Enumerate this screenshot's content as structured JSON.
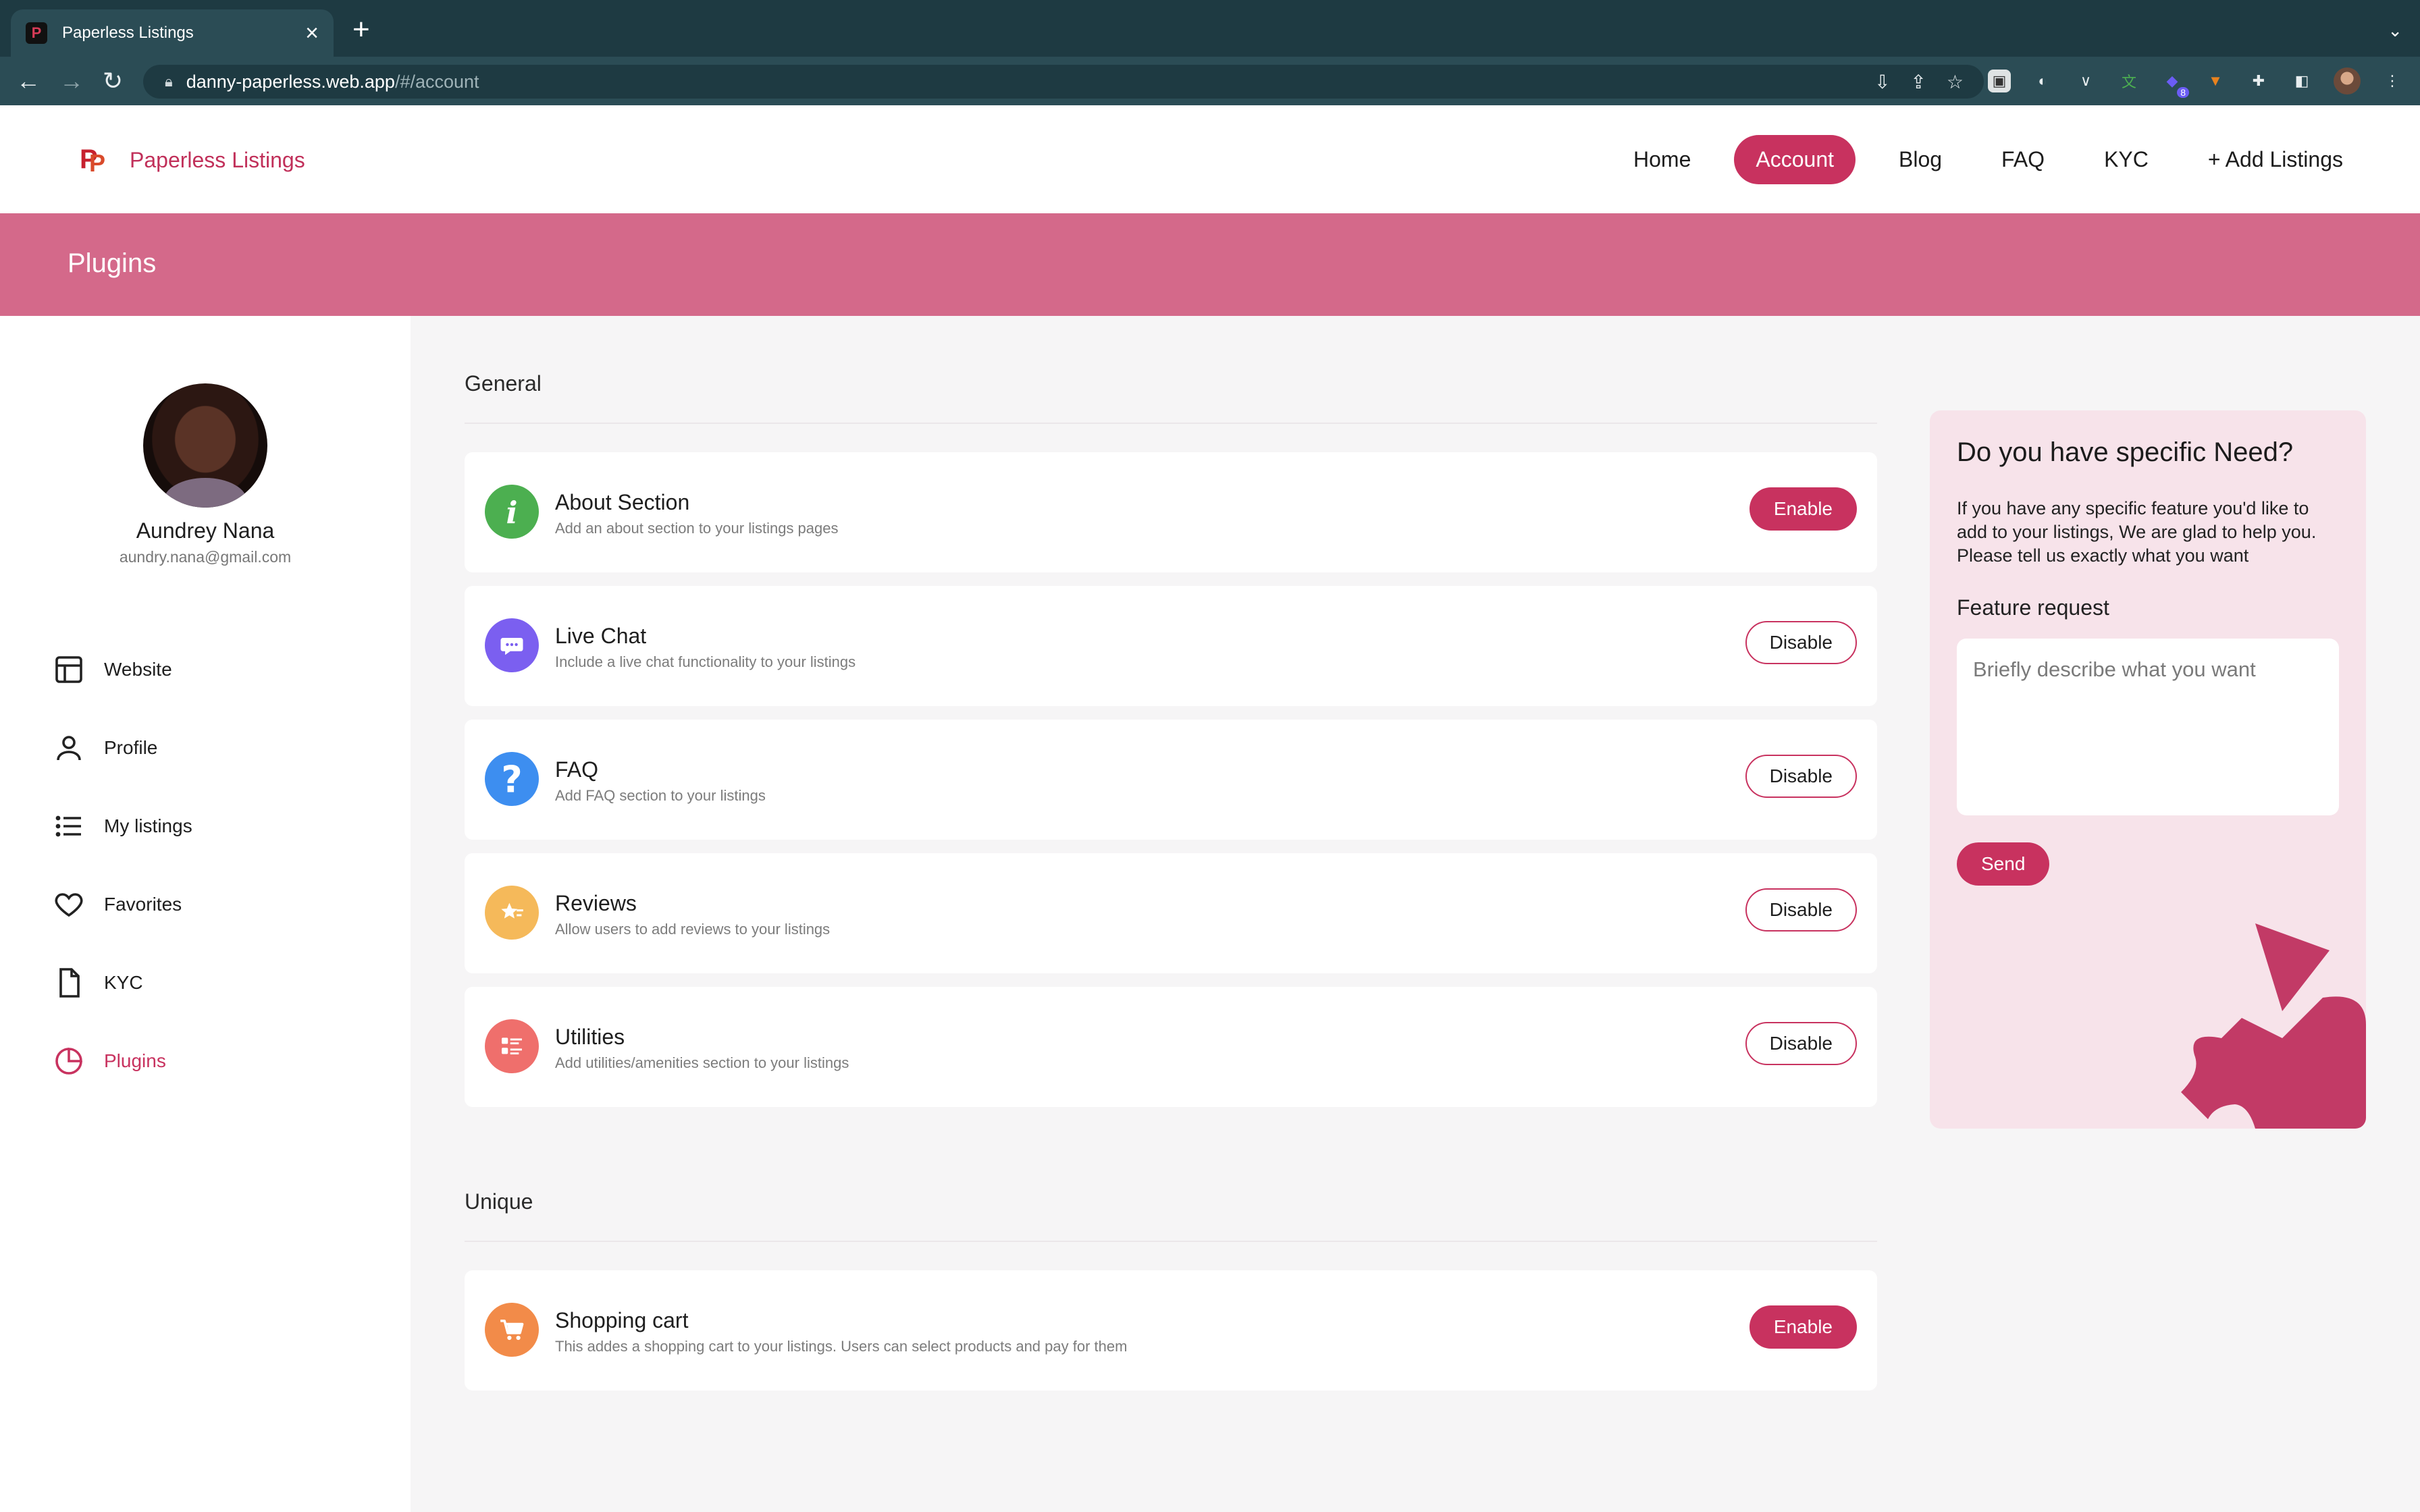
{
  "browser": {
    "tab_title": "Paperless Listings",
    "url_host": "danny-paperless.web.app",
    "url_path": "/#/account",
    "extension_badge": "8"
  },
  "header": {
    "logo_text": "Paperless Listings",
    "nav": [
      {
        "label": "Home"
      },
      {
        "label": "Account",
        "active": true
      },
      {
        "label": "Blog"
      },
      {
        "label": "FAQ"
      },
      {
        "label": "KYC"
      },
      {
        "label": "+ Add Listings"
      }
    ]
  },
  "banner": {
    "title": "Plugins"
  },
  "user": {
    "name": "Aundrey Nana",
    "email": "aundry.nana@gmail.com"
  },
  "sidebar": {
    "items": [
      {
        "label": "Website",
        "icon": "layout-icon"
      },
      {
        "label": "Profile",
        "icon": "user-icon"
      },
      {
        "label": "My listings",
        "icon": "list-icon"
      },
      {
        "label": "Favorites",
        "icon": "heart-icon"
      },
      {
        "label": "KYC",
        "icon": "document-icon"
      },
      {
        "label": "Plugins",
        "icon": "pie-chart-icon",
        "active": true
      }
    ]
  },
  "sections": {
    "general": {
      "title": "General",
      "plugins": [
        {
          "name": "About Section",
          "description": "Add an about section to your listings pages",
          "button": "Enable",
          "icon": "info-icon",
          "color": "#4caf50"
        },
        {
          "name": "Live Chat",
          "description": "Include a live chat functionality to your listings",
          "button": "Disable",
          "icon": "chat-icon",
          "color": "#7b5ff0"
        },
        {
          "name": "FAQ",
          "description": "Add FAQ section to your listings",
          "button": "Disable",
          "icon": "question-icon",
          "color": "#3d8ef0"
        },
        {
          "name": "Reviews",
          "description": "Allow users to add reviews to your listings",
          "button": "Disable",
          "icon": "star-review-icon",
          "color": "#f5b95a"
        },
        {
          "name": "Utilities",
          "description": "Add utilities/amenities section to your listings",
          "button": "Disable",
          "icon": "utilities-icon",
          "color": "#ef6f6c"
        }
      ]
    },
    "unique": {
      "title": "Unique",
      "plugins": [
        {
          "name": "Shopping cart",
          "description": "This addes a shopping cart to your listings. Users can select products and pay for them",
          "button": "Enable",
          "icon": "cart-icon",
          "color": "#f28b49"
        }
      ]
    }
  },
  "request": {
    "title": "Do you have specific Need?",
    "description": "If you have any specific feature you'd like to add to your listings, We are glad to help you. Please tell us exactly what you want",
    "label": "Feature request",
    "placeholder": "Briefly describe what you want",
    "send_label": "Send"
  },
  "colors": {
    "accent": "#c8325f",
    "banner": "#d4698a",
    "panel": "#f7e3ea"
  }
}
